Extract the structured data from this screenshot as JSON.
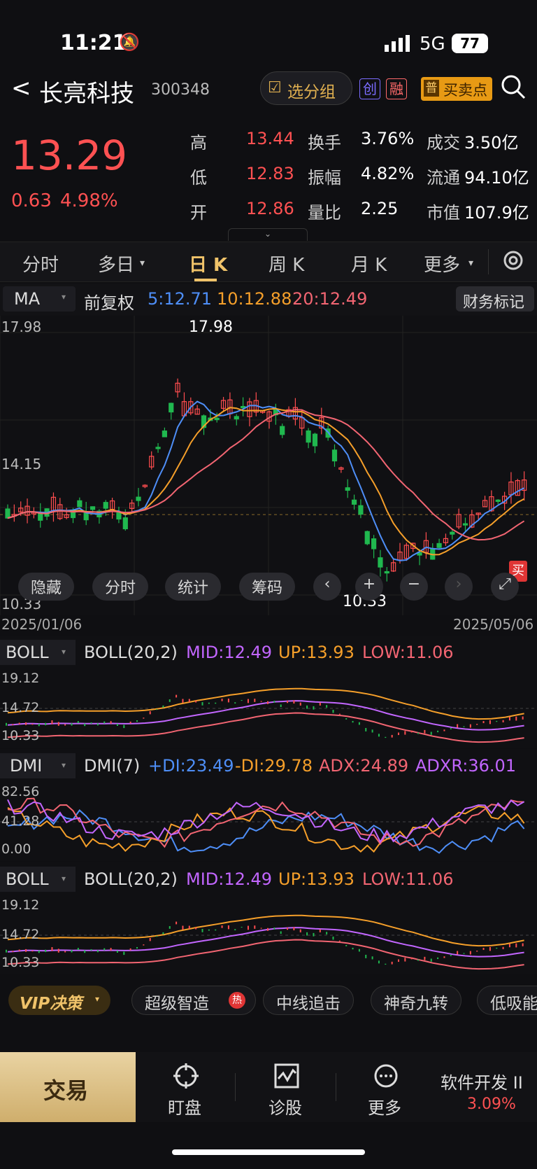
{
  "status": {
    "time": "11:21",
    "network": "5G",
    "battery": "77"
  },
  "header": {
    "back": "<",
    "name": "长亮科技",
    "code": "300348",
    "watch": "选分组",
    "tag1": "创",
    "tag2": "融",
    "buy_sell": "买卖点",
    "buy_sell_prefix": "普"
  },
  "quote": {
    "price": "13.29",
    "change": "0.63",
    "change_pct": "4.98%",
    "rows": [
      {
        "l1": "高",
        "v1": "13.44",
        "l2": "换手",
        "v2": "3.76%",
        "l3": "成交",
        "v3": "3.50亿"
      },
      {
        "l1": "低",
        "v1": "12.83",
        "l2": "振幅",
        "v2": "4.82%",
        "l3": "流通",
        "v3": "94.10亿"
      },
      {
        "l1": "开",
        "v1": "12.86",
        "l2": "量比",
        "v2": "2.25",
        "l3": "市值",
        "v3": "107.9亿"
      }
    ]
  },
  "tabs": [
    "分时",
    "多日",
    "日 K",
    "周 K",
    "月 K",
    "更多"
  ],
  "ma_bar": {
    "ma": "MA",
    "adj": "前复权",
    "ma5": "5:12.71",
    "ma10": "10:12.88",
    "ma20": "20:12.49",
    "fin": "财务标记"
  },
  "chart": {
    "y_top": "17.98",
    "y_mid": "14.15",
    "y_bot": "10.33",
    "high_label": "17.98",
    "low_label": "10.33",
    "date_start": "2025/01/06",
    "date_end": "2025/05/06",
    "buy_marker": "买",
    "controls": [
      "隐藏",
      "分时",
      "统计",
      "筹码"
    ]
  },
  "chart_data": {
    "type": "candlestick",
    "ylim": [
      10.33,
      17.98
    ],
    "x_range": [
      "2025/01/06",
      "2025/05/06"
    ],
    "series": [
      {
        "name": "MA5",
        "value": 12.71
      },
      {
        "name": "MA10",
        "value": 12.88
      },
      {
        "name": "MA20",
        "value": 12.49
      }
    ]
  },
  "boll1": {
    "name": "BOLL",
    "params": "BOLL(20,2)",
    "mid": "MID:12.49",
    "up": "UP:13.93",
    "low": "LOW:11.06",
    "y1": "19.12",
    "y2": "14.72",
    "y3": "10.33"
  },
  "dmi": {
    "name": "DMI",
    "params": "DMI(7)",
    "pdi": "+DI:23.49",
    "mdi": "-DI:29.78",
    "adx": "ADX:24.89",
    "adxr": "ADXR:36.01",
    "y1": "82.56",
    "y2": "41.28",
    "y3": "0.00"
  },
  "boll2": {
    "name": "BOLL",
    "params": "BOLL(20,2)",
    "mid": "MID:12.49",
    "up": "UP:13.93",
    "low": "LOW:11.06",
    "y1": "19.12",
    "y2": "14.72",
    "y3": "10.33"
  },
  "vip": {
    "label": "VIP决策",
    "chips": [
      "超级智造",
      "中线追击",
      "神奇九转",
      "低吸能"
    ],
    "hot": "热"
  },
  "bottom": {
    "trade": "交易",
    "watch": "盯盘",
    "diagnose": "诊股",
    "more": "更多",
    "sector": "软件开发 II",
    "sector_pct": "3.09%"
  }
}
